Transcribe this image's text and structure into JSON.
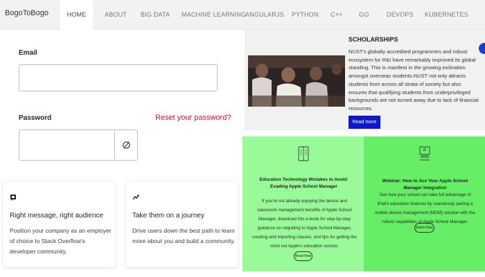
{
  "nav": {
    "brand": "BogoToBogo",
    "items": [
      {
        "label": "HOME"
      },
      {
        "label": "ABOUT"
      },
      {
        "label": "BIG DATA"
      },
      {
        "label": "MACHINE LEARNING"
      },
      {
        "label": "ANGULARJS"
      },
      {
        "label": "PYTHON"
      },
      {
        "label": "C++"
      },
      {
        "label": "GO"
      },
      {
        "label": "DEVOPS"
      },
      {
        "label": "KUBERNETES"
      }
    ]
  },
  "login": {
    "email_label": "Email",
    "email_value": "",
    "password_label": "Password",
    "password_value": "",
    "reset_link": "Reset your password?"
  },
  "features": [
    {
      "title": "Right message, right audience",
      "desc": "Position your company as an employer of choice to Stack Overflow's developer community."
    },
    {
      "title": "Take them on a journey",
      "desc": "Drive users down the best path to learn more about you and build a community."
    }
  ],
  "scholarships": {
    "title": "SCHOLARSHIPS",
    "text": "NUST's globally accredited programmes and robust ecosystem for R&I have remarkably improved its global standing. This is manifest in the growing inclination amongst overseas students.NUST not only attracts students from across all strata of society but also ensures that qualifying students from underprivileged backgrounds are not turned away due to lack of financial resources.",
    "button": "Read more"
  },
  "panels": [
    {
      "title": "Education Technology Mistakes to Avoid: Evading Apple School Manager",
      "desc": "If you're not already enjoying the device and classroom management benefits of Apple School Manager, download this e-book for step-by-step guidance on migrating to Apple School Manager, creating and importing classes, and tips for getting the most out Apple's education service.",
      "button": "Read Now",
      "color": "#98fb98"
    },
    {
      "title": "Webinar: How to Ace Your Apple School Manager Integration",
      "desc": "See how your school can take full advantage of iPad's education features by seamlessly pairing a mobile device management (MDM) solution with the robust capabilities of Apple School Manager.",
      "button": "Watch Now",
      "color": "#66ee66"
    }
  ],
  "icons": {
    "visibility_toggle": "eye-off-icon",
    "feature_1": "message-icon",
    "feature_2": "trend-icon",
    "panel_1": "book-icon",
    "panel_2": "presentation-icon"
  },
  "colors": {
    "reset_link": "#c0183a",
    "read_more_button": "#0f16cf",
    "panel_left": "#98fb98",
    "panel_right": "#66ee66"
  }
}
